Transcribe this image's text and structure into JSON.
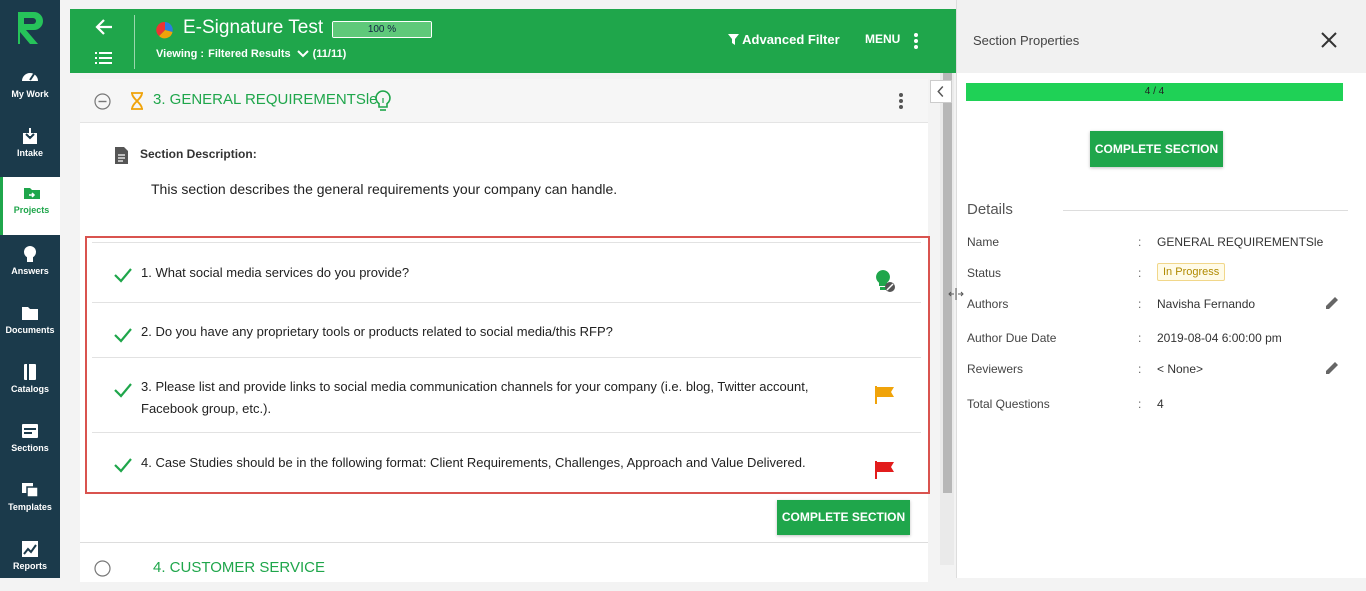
{
  "nav": {
    "items": [
      {
        "label": "My Work",
        "icon": "gauge-icon"
      },
      {
        "label": "Intake",
        "icon": "inbox-icon"
      },
      {
        "label": "Projects",
        "icon": "folder-icon"
      },
      {
        "label": "Answers",
        "icon": "lightbulb-icon"
      },
      {
        "label": "Documents",
        "icon": "document-icon"
      },
      {
        "label": "Catalogs",
        "icon": "book-icon"
      },
      {
        "label": "Sections",
        "icon": "sections-icon"
      },
      {
        "label": "Templates",
        "icon": "templates-icon"
      },
      {
        "label": "Reports",
        "icon": "chart-icon"
      }
    ],
    "active": "Projects"
  },
  "header": {
    "project_title": "E-Signature Test",
    "progress_text": "100 %",
    "progress_fraction": 1.0,
    "viewing_label": "Viewing :",
    "viewing_value": "Filtered Results",
    "viewing_count": "(11/11)",
    "advanced_filter": "Advanced Filter",
    "menu_label": "MENU"
  },
  "section": {
    "title": "3. GENERAL REQUIREMENTSle",
    "description_label": "Section Description:",
    "description_text": "This section describes the general requirements your company can handle.",
    "complete_label": "COMPLETE SECTION",
    "next_section_title": "4. CUSTOMER SERVICE"
  },
  "questions": [
    {
      "text": "1. What social media services do you provide?",
      "marker": "bulb"
    },
    {
      "text": "2. Do you have any proprietary tools or products related to social media/this RFP?",
      "marker": "none"
    },
    {
      "text": "3. Please list and provide links to social media communication channels for your company (i.e. blog, Twitter account, Facebook group, etc.).",
      "marker": "flag-orange"
    },
    {
      "text": "4. Case Studies should be in the following format: Client Requirements, Challenges, Approach and Value Delivered.",
      "marker": "flag-red"
    }
  ],
  "right_panel": {
    "title": "Section Properties",
    "progress_text": "4 / 4",
    "progress_fraction": 1.0,
    "complete_label": "COMPLETE SECTION",
    "details_heading": "Details",
    "details": [
      {
        "label": "Name",
        "value": "GENERAL REQUIREMENTSle"
      },
      {
        "label": "Status",
        "value": "In Progress"
      },
      {
        "label": "Authors",
        "value": "Navisha Fernando"
      },
      {
        "label": "Author Due Date",
        "value": "2019-08-04 6:00:00 pm"
      },
      {
        "label": "Reviewers",
        "value": "< None>"
      },
      {
        "label": "Total Questions",
        "value": "4"
      }
    ]
  },
  "colors": {
    "brand_green": "#1fa64b",
    "nav_bg": "#1b3a4b",
    "highlight_border": "#d9534f",
    "flag_orange": "#f0a30a",
    "flag_red": "#e21c1c"
  }
}
